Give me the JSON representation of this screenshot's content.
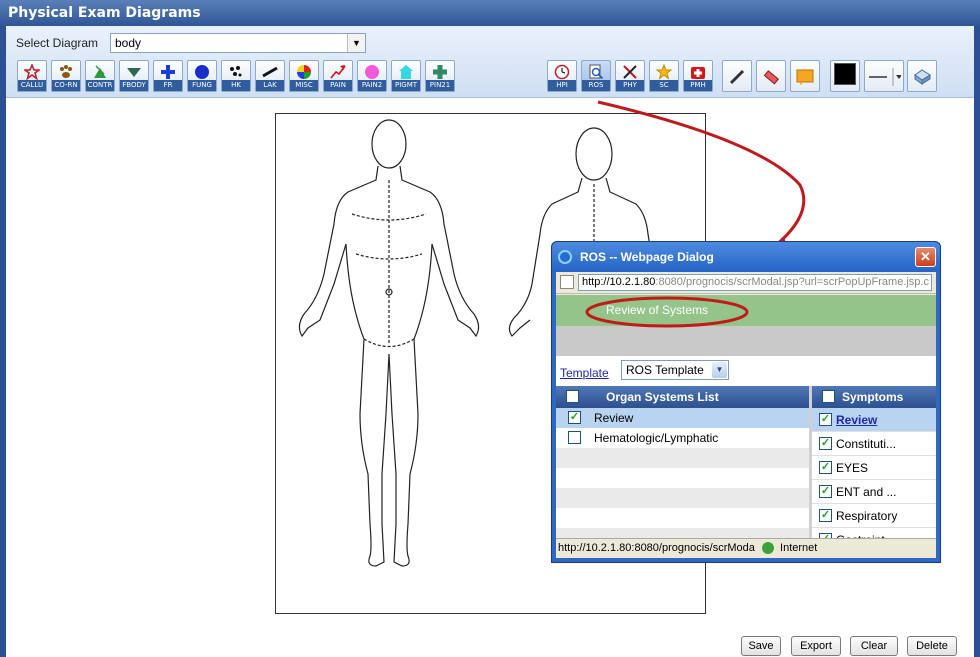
{
  "window": {
    "title": "Physical Exam Diagrams"
  },
  "diagram": {
    "label": "Select Diagram",
    "value": "body"
  },
  "tools_left": [
    {
      "label": "CALLU",
      "icon": "star-outline-icon"
    },
    {
      "label": "CO-RN",
      "icon": "paw-icon"
    },
    {
      "label": "CONTR",
      "icon": "contract-icon"
    },
    {
      "label": "FBODY",
      "icon": "triangle-down-icon"
    },
    {
      "label": "FR",
      "icon": "plus-icon"
    },
    {
      "label": "FUNG",
      "icon": "circle-icon"
    },
    {
      "label": "HK",
      "icon": "dots-icon"
    },
    {
      "label": "LAK",
      "icon": "slash-icon"
    },
    {
      "label": "MISC",
      "icon": "color-wheel-icon"
    },
    {
      "label": "PAIN",
      "icon": "arrow-up-right-icon"
    },
    {
      "label": "PAIN2",
      "icon": "pink-circle-icon"
    },
    {
      "label": "PIGMT",
      "icon": "house-icon"
    },
    {
      "label": "PIN21",
      "icon": "green-plus-icon"
    }
  ],
  "tools_right": [
    {
      "label": "HPI",
      "icon": "clock-icon"
    },
    {
      "label": "ROS",
      "icon": "magnifier-icon"
    },
    {
      "label": "PHY",
      "icon": "stethoscope-icon"
    },
    {
      "label": "SC",
      "icon": "star-icon"
    },
    {
      "label": "PMH",
      "icon": "medkit-icon"
    }
  ],
  "buttons": {
    "save": "Save",
    "export": "Export",
    "clear": "Clear",
    "delete": "Delete"
  },
  "dialog": {
    "title": "ROS -- Webpage Dialog",
    "close": "✕",
    "url_host": "http://10.2.1.80",
    "url_rest": ":8080/prognocis/scrModal.jsp?url=scrPopUpFrame.jsp.c",
    "section_title": "Review of Systems",
    "template_link": "Template",
    "template_value": "ROS Template",
    "organ_header": "Organ Systems List",
    "symptoms_header": "Symptoms",
    "organs": [
      "Review",
      "Hematologic/Lymphatic"
    ],
    "symptoms": [
      "Review",
      "Constituti...",
      "EYES",
      "ENT and ...",
      "Respiratory",
      "Gastroint"
    ],
    "status_url": "http://10.2.1.80:8080/prognocis/scrModa",
    "status_zone": "Internet"
  }
}
